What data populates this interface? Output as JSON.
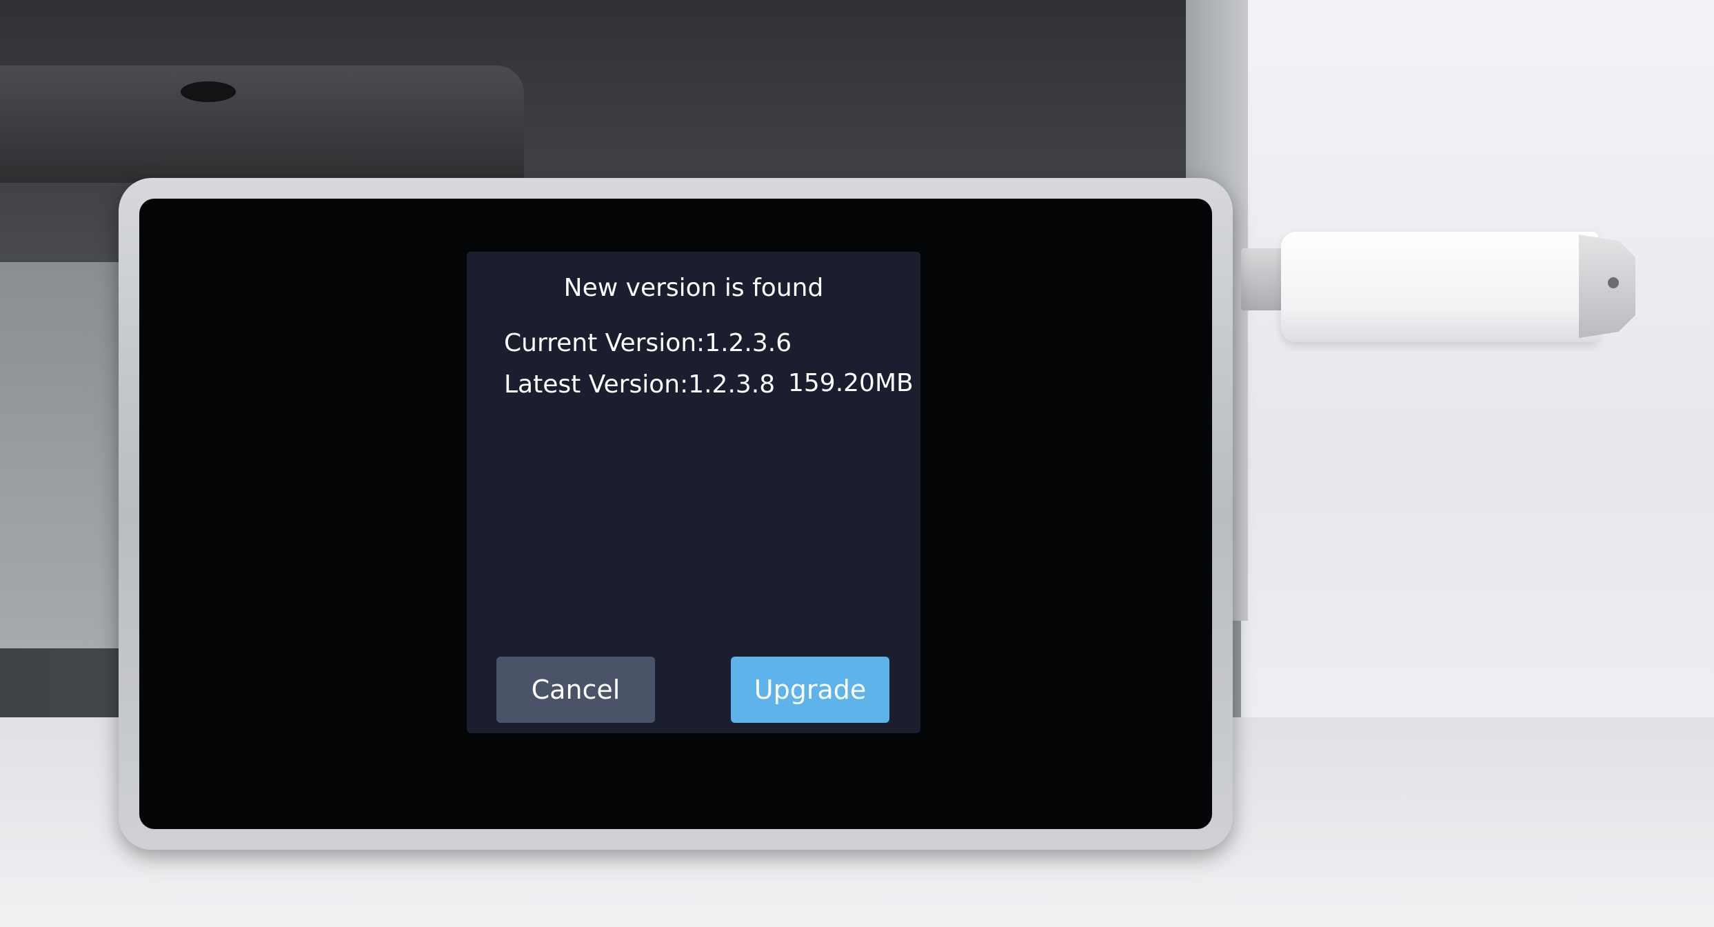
{
  "dialog": {
    "title": "New version is found",
    "current_version": "Current Version:1.2.3.6",
    "latest_version": "Latest Version:1.2.3.8",
    "file_size": "159.20MB",
    "cancel_label": "Cancel",
    "upgrade_label": "Upgrade"
  },
  "colors": {
    "dialog_background": "#1a1e2f",
    "cancel_button": "#4a5368",
    "upgrade_button": "#5eb3ea",
    "screen_background": "#040506"
  }
}
